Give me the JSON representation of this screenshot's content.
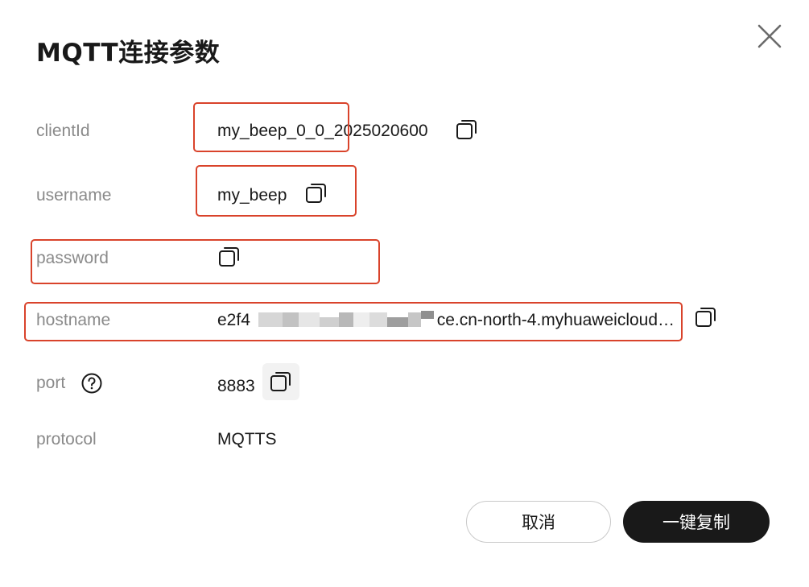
{
  "dialog": {
    "title": "MQTT连接参数",
    "close_icon": "close-icon"
  },
  "fields": {
    "clientId": {
      "label": "clientId",
      "value": "my_beep_0_0_2025020600"
    },
    "username": {
      "label": "username",
      "value": "my_beep"
    },
    "password": {
      "label": "password",
      "value": ""
    },
    "hostname": {
      "label": "hostname",
      "value_start": "e2f4",
      "value_end": "ce.cn-north-4.myhuaweicloud…"
    },
    "port": {
      "label": "port",
      "value": "8883",
      "help_icon": "question-circle-icon"
    },
    "protocol": {
      "label": "protocol",
      "value": "MQTTS"
    }
  },
  "buttons": {
    "cancel": "取消",
    "copy_all": "一键复制"
  },
  "colors": {
    "primary_button_bg": "#191919",
    "annotation_red": "#d9432b",
    "label_gray": "#8a8a8a"
  }
}
